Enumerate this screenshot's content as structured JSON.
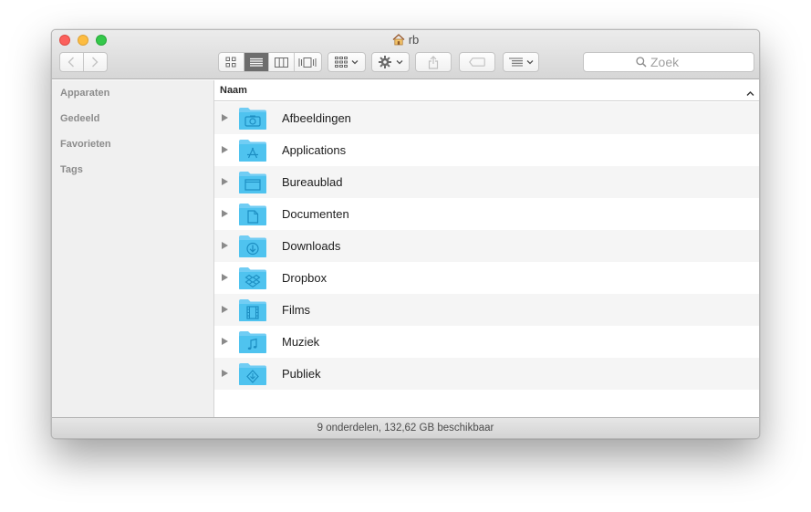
{
  "window": {
    "title": "rb"
  },
  "toolbar": {
    "search_placeholder": "Zoek",
    "active_view": "list"
  },
  "sidebar": {
    "sections": [
      "Apparaten",
      "Gedeeld",
      "Favorieten",
      "Tags"
    ]
  },
  "columns": {
    "name": "Naam"
  },
  "items": [
    {
      "label": "Afbeeldingen",
      "icon": "camera-icon"
    },
    {
      "label": "Applications",
      "icon": "app-store-icon"
    },
    {
      "label": "Bureaublad",
      "icon": "desktop-icon"
    },
    {
      "label": "Documenten",
      "icon": "document-icon"
    },
    {
      "label": "Downloads",
      "icon": "download-icon"
    },
    {
      "label": "Dropbox",
      "icon": "dropbox-icon"
    },
    {
      "label": "Films",
      "icon": "film-icon"
    },
    {
      "label": "Muziek",
      "icon": "music-note-icon"
    },
    {
      "label": "Publiek",
      "icon": "public-icon"
    }
  ],
  "status": {
    "text": "9 onderdelen, 132,62 GB beschikbaar"
  },
  "colors": {
    "close": "#fc605c",
    "minimize": "#fdbc40",
    "maximize": "#34c84a",
    "folder": "#4fc3ef",
    "row_alt": "#f5f5f5"
  }
}
